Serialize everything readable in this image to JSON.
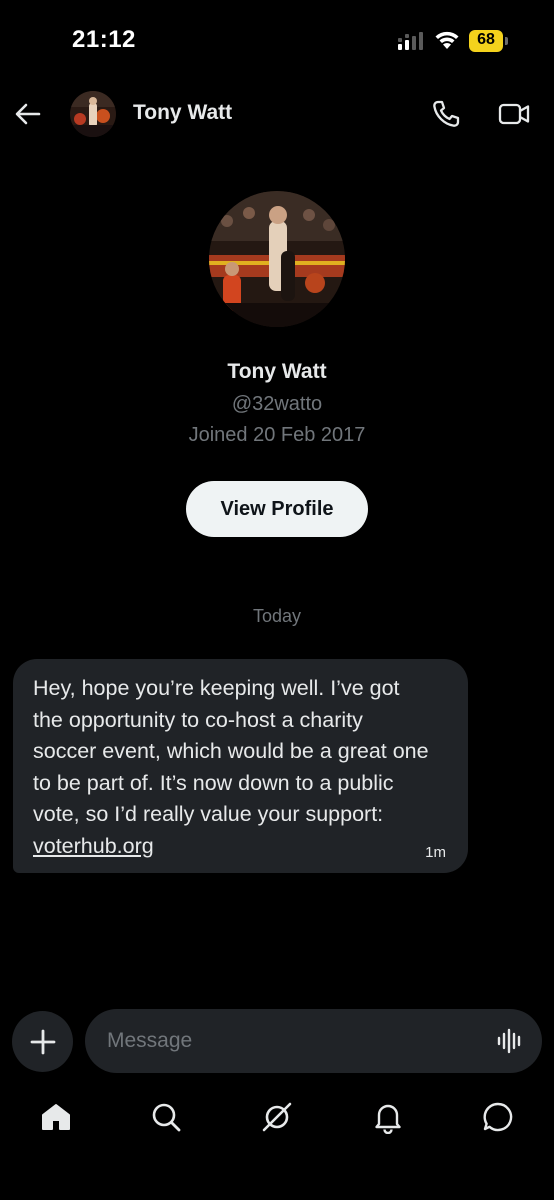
{
  "status_bar": {
    "time": "21:12",
    "battery": "68"
  },
  "header": {
    "name": "Tony Watt"
  },
  "profile": {
    "name": "Tony Watt",
    "handle": "@32watto",
    "joined": "Joined 20 Feb 2017",
    "view_profile_label": "View Profile"
  },
  "conversation": {
    "day_label": "Today",
    "messages": [
      {
        "text": "Hey, hope you’re keeping well. I’ve got\nthe opportunity to co-host a charity\nsoccer event, which would be a great one\nto be part of. It’s now down to a public\nvote, so I’d really value your support:",
        "link": "voterhub.org",
        "time": "1m"
      }
    ]
  },
  "composer": {
    "placeholder": "Message"
  },
  "nav": {
    "items": [
      "home-icon",
      "search-icon",
      "grok-icon",
      "notifications-icon",
      "messages-icon"
    ]
  },
  "colors": {
    "background": "#000000",
    "bubble": "#202327",
    "muted_text": "#71767b",
    "primary_text": "#e7e9ea",
    "battery": "#f4d21c"
  }
}
